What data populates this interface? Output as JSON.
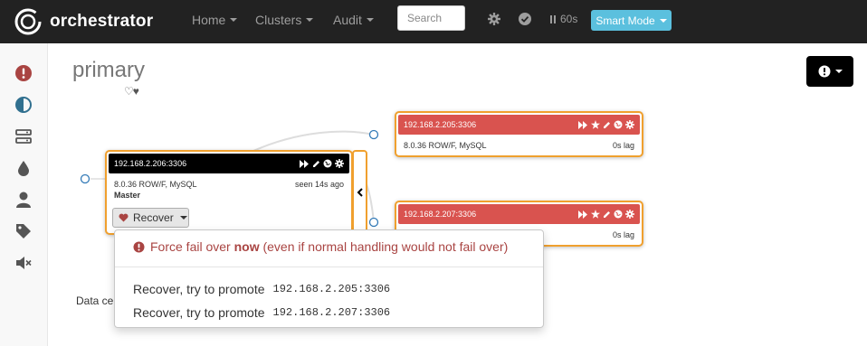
{
  "navbar": {
    "brand": "orchestrator",
    "menu": [
      {
        "label": "Home"
      },
      {
        "label": "Clusters"
      },
      {
        "label": "Audit"
      }
    ],
    "search_placeholder": "Search",
    "refresh_label": "60s",
    "smart_mode_label": "Smart Mode"
  },
  "sidebar": {
    "icons": [
      "exclamation-circle-icon",
      "adjust-icon",
      "server-icon",
      "tint-icon",
      "user-icon",
      "tag-icon",
      "volume-off-icon"
    ]
  },
  "page": {
    "title": "primary",
    "hearts": "♡♥",
    "datacenter_label": "Data center"
  },
  "colors": {
    "navbar_bg": "#222222",
    "instance_border": "#f0a02e",
    "header_red": "#d9534f",
    "danger_text": "#a94442",
    "smart_mode_bg": "#5bc0de"
  },
  "instances": {
    "master": {
      "host": "192.168.2.206:3306",
      "version": "8.0.36 ROW/F, MySQL",
      "seen": "seen 14s ago",
      "role": "Master",
      "recover_label": "Recover"
    },
    "replica1": {
      "host": "192.168.2.205:3306",
      "version": "8.0.36 ROW/F, MySQL",
      "lag": "0s lag"
    },
    "replica2": {
      "host": "192.168.2.207:3306",
      "lag": "0s lag"
    }
  },
  "recover_menu": {
    "force_prefix": "Force fail over ",
    "force_bold": "now",
    "force_suffix": " (even if normal handling would not fail over)",
    "option_label": "Recover, try to promote",
    "option1_host": "192.168.2.205:3306",
    "option2_host": "192.168.2.207:3306"
  }
}
